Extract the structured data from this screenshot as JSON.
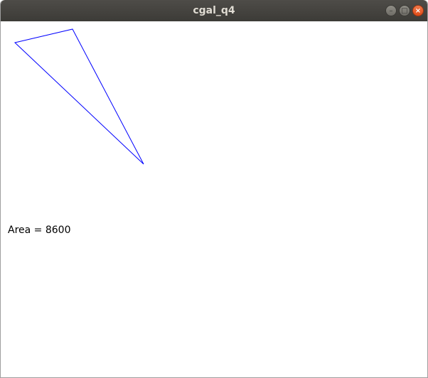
{
  "window": {
    "title": "cgal_q4",
    "controls": {
      "minimize_icon": "minimize-icon",
      "maximize_icon": "maximize-icon",
      "close_icon": "close-icon",
      "minimize_glyph": "–",
      "maximize_glyph": "□",
      "close_glyph": "×"
    },
    "colors": {
      "titlebar": "#3c3b37",
      "close": "#e95420"
    }
  },
  "canvas": {
    "triangle_color": "#0000ff",
    "area_text": "Area = 8600"
  }
}
